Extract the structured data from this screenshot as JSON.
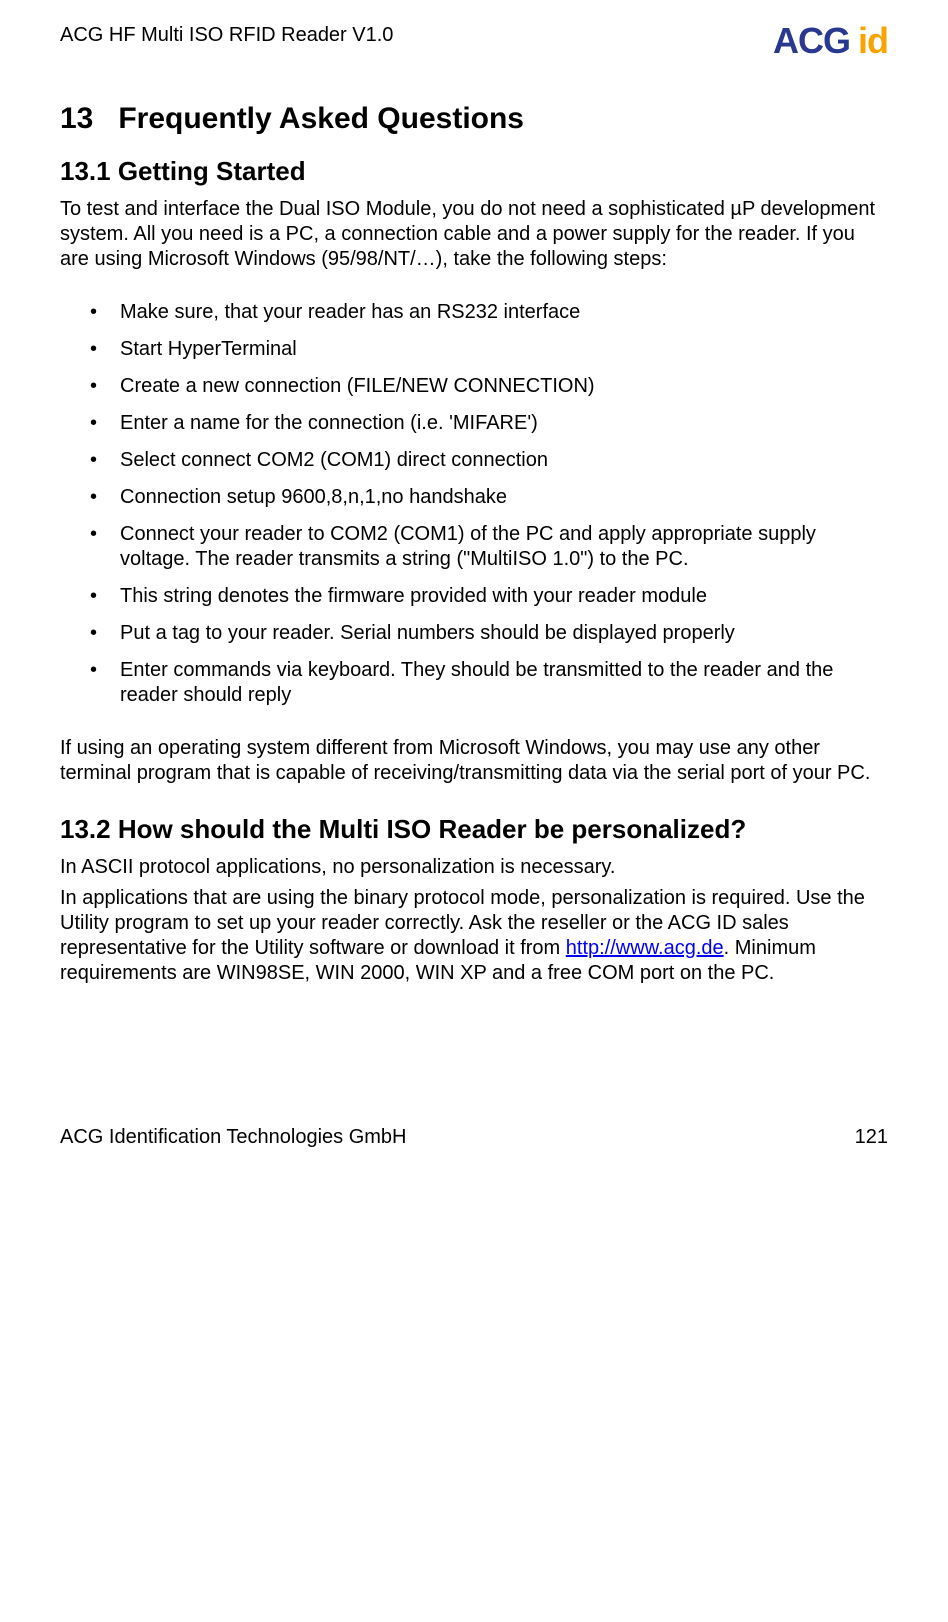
{
  "header": {
    "doc_title": "ACG HF Multi ISO RFID Reader V1.0",
    "logo_text_a": "ACG",
    "logo_text_b": "id"
  },
  "section": {
    "number": "13",
    "title": "Frequently Asked Questions"
  },
  "sub1": {
    "number_title": "13.1 Getting Started",
    "intro": "To test and interface the Dual ISO Module, you do not need a sophisticated µP development system. All you need is a PC, a connection cable and a power supply for the reader. If you are using Microsoft Windows (95/98/NT/…), take the following steps:",
    "bullets": [
      "Make sure, that your reader has an RS232 interface",
      "Start HyperTerminal",
      "Create a new connection (FILE/NEW CONNECTION)",
      "Enter a name for the connection (i.e. 'MIFARE')",
      "Select connect COM2 (COM1) direct connection",
      "Connection setup 9600,8,n,1,no handshake",
      "Connect your reader to COM2 (COM1) of the PC and apply appropriate supply voltage. The reader transmits a string (\"MultiISO 1.0\") to the PC.",
      "This string denotes the firmware provided with your reader module",
      "Put a tag to your reader. Serial numbers should be displayed properly",
      "Enter commands via keyboard. They should be transmitted to the reader and the reader should reply"
    ],
    "outro": "If using an operating system different from Microsoft Windows, you may use any other terminal program that is capable of receiving/transmitting data via the serial port of your PC."
  },
  "sub2": {
    "number_title": "13.2 How should the Multi ISO Reader be personalized?",
    "p1": "In ASCII protocol applications, no personalization is necessary.",
    "p2_a": "In applications that are using the binary protocol mode, personalization is required. Use the Utility program to set up your reader correctly. Ask the reseller or the ACG ID sales representative for the Utility software or download it from ",
    "p2_link": "http://www.acg.de",
    "p2_b": ". Minimum requirements are WIN98SE, WIN 2000, WIN XP and a free COM port on the PC."
  },
  "footer": {
    "company": "ACG Identification Technologies GmbH",
    "page": "121"
  }
}
